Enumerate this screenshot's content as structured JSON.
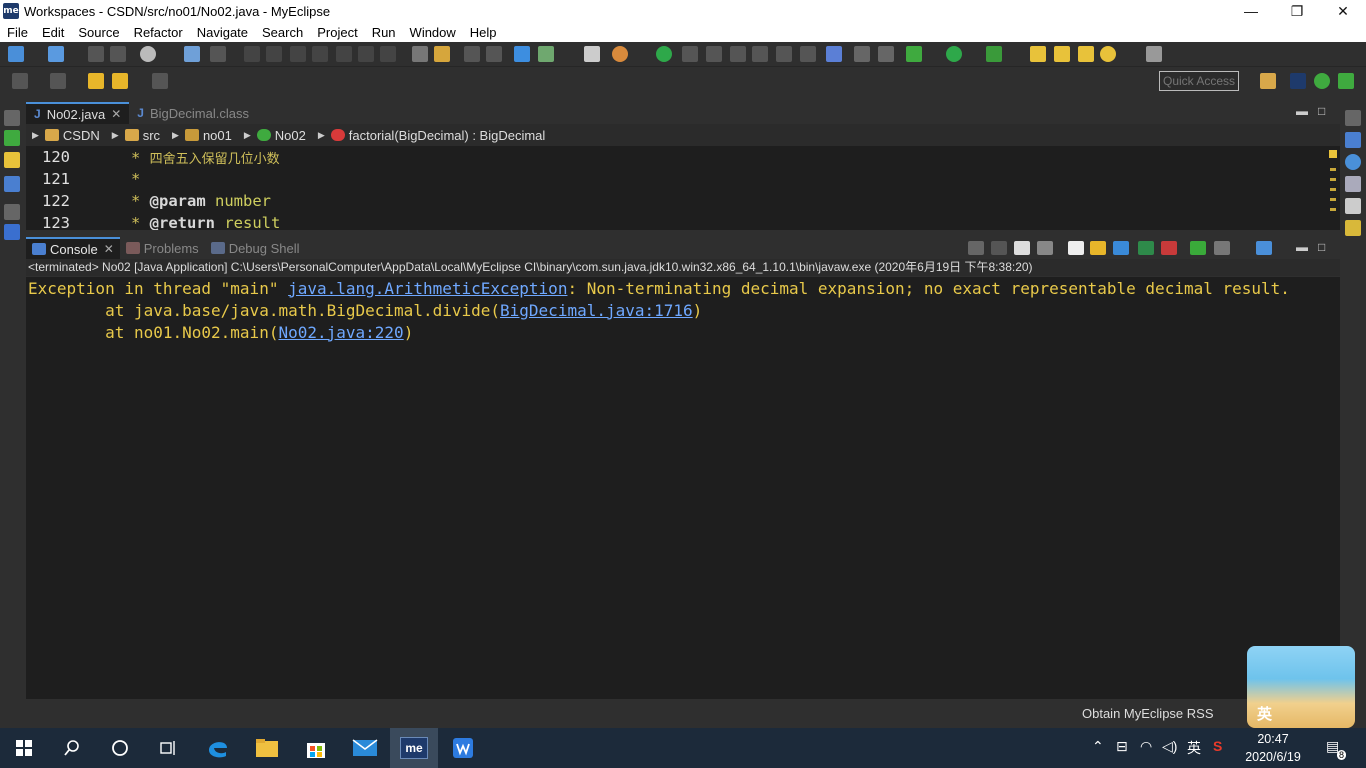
{
  "window": {
    "title": "Workspaces - CSDN/src/no01/No02.java - MyEclipse",
    "logo": "me",
    "minimize": "—",
    "restore": "❐",
    "close": "✕"
  },
  "menu": [
    "File",
    "Edit",
    "Source",
    "Refactor",
    "Navigate",
    "Search",
    "Project",
    "Run",
    "Window",
    "Help"
  ],
  "quick_access": {
    "placeholder": "Quick Access"
  },
  "editor_tabs": [
    {
      "label": "No02.java",
      "active": true,
      "icon": "java-file-icon"
    },
    {
      "label": "BigDecimal.class",
      "active": false,
      "icon": "class-file-icon"
    }
  ],
  "breadcrumb": [
    "CSDN",
    "src",
    "no01",
    "No02",
    "factorial(BigDecimal) : BigDecimal"
  ],
  "editor_lines": [
    {
      "num": "120",
      "star": "* ",
      "kw": "",
      "text": "四舍五入保留几位小数"
    },
    {
      "num": "121",
      "star": "*",
      "kw": "",
      "text": ""
    },
    {
      "num": "122",
      "star": "* ",
      "kw": "@param",
      "text": " number"
    },
    {
      "num": "123",
      "star": "* ",
      "kw": "@return",
      "text": " result"
    }
  ],
  "console_tabs": [
    {
      "label": "Console",
      "active": true,
      "icon": "console-icon"
    },
    {
      "label": "Problems",
      "active": false,
      "icon": "problems-icon"
    },
    {
      "label": "Debug Shell",
      "active": false,
      "icon": "debug-shell-icon"
    }
  ],
  "console": {
    "terminated": "<terminated> No02 [Java Application] C:\\Users\\PersonalComputer\\AppData\\Local\\MyEclipse CI\\binary\\com.sun.java.jdk10.win32.x86_64_1.10.1\\bin\\javaw.exe (2020年6月19日 下午8:38:20)",
    "line1_prefix": "Exception in thread \"main\" ",
    "line1_link": "java.lang.ArithmeticException",
    "line1_suffix": ": Non-terminating decimal expansion; no exact representable decimal result.",
    "line2_prefix": "        at java.base/java.math.BigDecimal.divide(",
    "line2_link": "BigDecimal.java:1716",
    "line2_suffix": ")",
    "line3_prefix": "        at no01.No02.main(",
    "line3_link": "No02.java:220",
    "line3_suffix": ")"
  },
  "status": {
    "rss": "Obtain MyEclipse RSS"
  },
  "ime": {
    "text": "英"
  },
  "taskbar": {
    "time": "20:47",
    "date": "2020/6/19",
    "lang": "英",
    "notifications": "8"
  },
  "colors": {
    "accent": "#4a90d9",
    "console_text": "#e8c94a",
    "link": "#6fa8ff",
    "taskbar": "#1c2a3a"
  }
}
